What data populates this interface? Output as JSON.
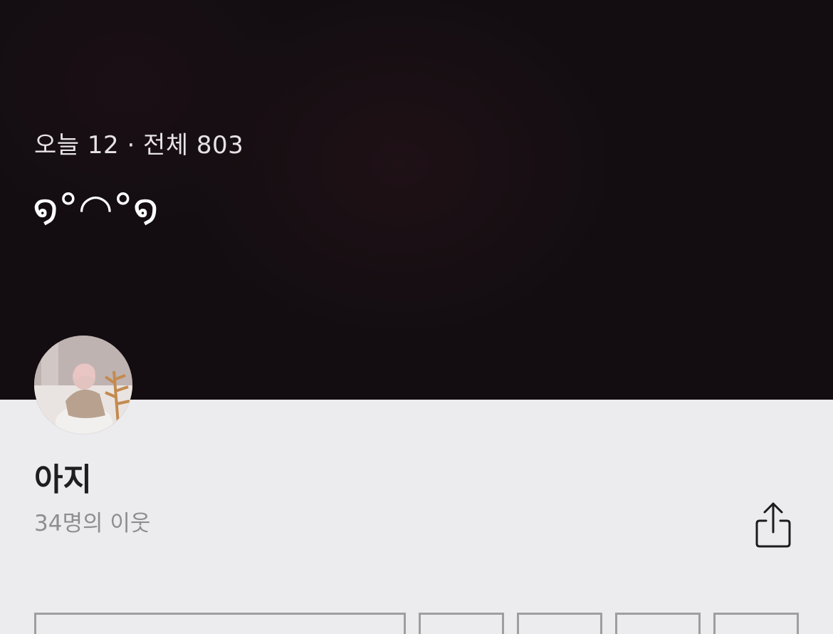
{
  "header": {
    "visits_text": "오늘 12 · 전체 803",
    "blog_title": "໑°◠°໑"
  },
  "profile": {
    "avatar_icon": "profile-photo",
    "name": "아지",
    "neighbors": "34명의 이웃"
  },
  "actions": {
    "share_icon": "share-icon"
  },
  "colors": {
    "hero_bg": "#130d11",
    "page_bg": "#ececee",
    "name_text": "#1e1e1e",
    "secondary_text": "#8e8e8e"
  }
}
